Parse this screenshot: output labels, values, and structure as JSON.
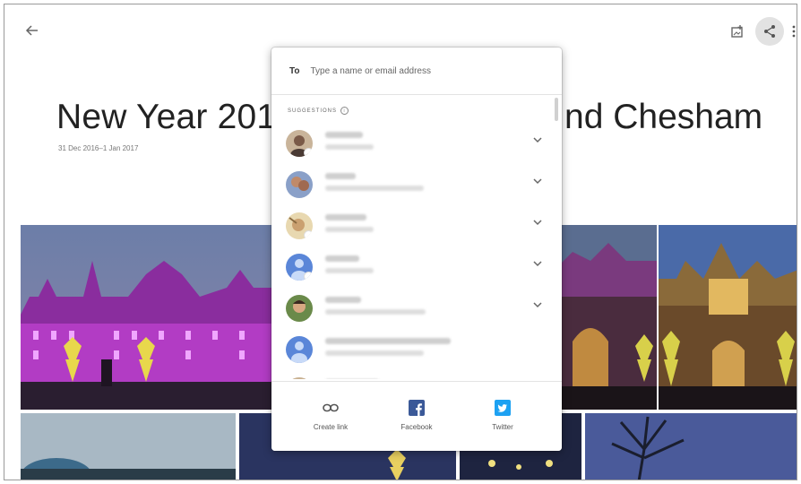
{
  "album": {
    "title_left": "New Year 201",
    "title_right": "nd Chesham",
    "date_range": "31 Dec 2016–1 Jan 2017"
  },
  "toolbar": {
    "back_icon": "arrow-back-icon",
    "add_icon": "add-to-album-icon",
    "share_icon": "share-icon",
    "more_icon": "more-vert-icon"
  },
  "share_dialog": {
    "to_label": "To",
    "to_placeholder": "Type a name or email address",
    "suggestions_label": "SUGGESTIONS",
    "actions": [
      {
        "label": "Create link",
        "icon": "link-icon"
      },
      {
        "label": "Facebook",
        "icon": "facebook-icon",
        "color": "#3b5998"
      },
      {
        "label": "Twitter",
        "icon": "twitter-icon",
        "color": "#1da1f2"
      }
    ]
  },
  "colors": {
    "accent_share_bg": "#e2e2e2",
    "facebook": "#3b5998",
    "twitter": "#1da1f2"
  }
}
